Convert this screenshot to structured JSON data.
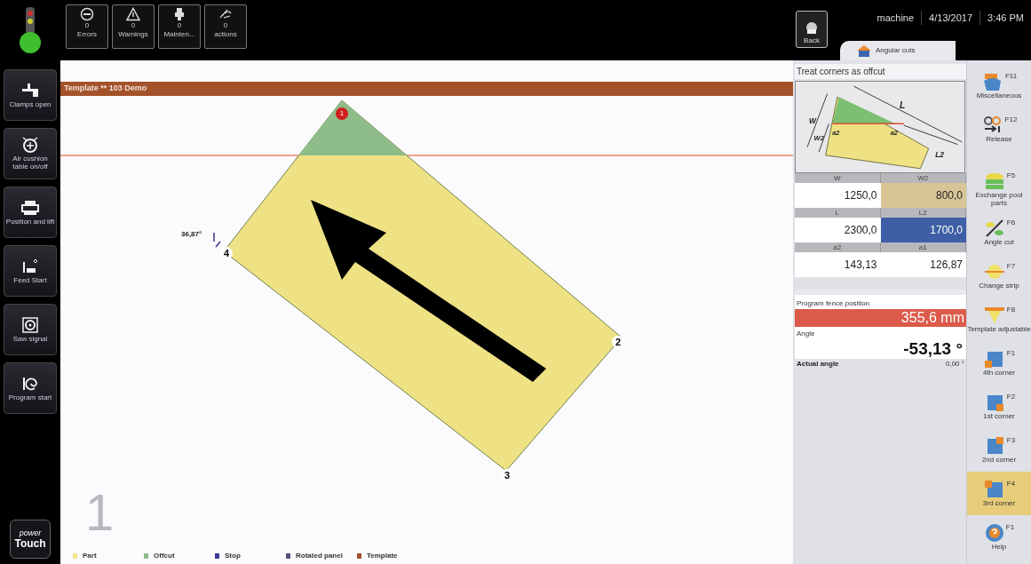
{
  "top_buttons": [
    {
      "count": "0",
      "label": "Errors"
    },
    {
      "count": "0",
      "label": "Warnings"
    },
    {
      "count": "0",
      "label": "Mainten..."
    },
    {
      "count": "0",
      "label": "actions"
    }
  ],
  "back_button": {
    "label": "Back"
  },
  "header": {
    "user": "machine",
    "date": "4/13/2017",
    "time": "3:46 PM"
  },
  "tab": {
    "label": "Angular cuts",
    "selected": true
  },
  "left_buttons": [
    {
      "label": "Clamps open"
    },
    {
      "label": "Air cushion table on/off"
    },
    {
      "label": "Position and lift"
    },
    {
      "label": "Feed Start"
    },
    {
      "label": "Saw signal"
    },
    {
      "label": "Program start"
    }
  ],
  "logo": {
    "line1": "power",
    "line2": "Touch"
  },
  "canvas": {
    "template_bar": "Template ** 103 Demo",
    "corners": [
      "1",
      "2",
      "3",
      "4"
    ],
    "angle_mark": "36,87°",
    "step": "1",
    "legend": [
      {
        "label": "Part",
        "color": "#f0e68c"
      },
      {
        "label": "Offcut",
        "color": "#8fbc8f"
      },
      {
        "label": "Stop",
        "color": "#3a3a9a"
      },
      {
        "label": "Rotated panel",
        "color": "#555577"
      },
      {
        "label": "Template",
        "color": "#a0522d"
      }
    ]
  },
  "panel": {
    "title": "Treat corners as offcut",
    "diagram_labels": [
      "W",
      "W2",
      "L",
      "L2",
      "a2",
      "a2"
    ],
    "fields": [
      {
        "label": "W",
        "value": "1250,0",
        "highlighted": false,
        "selected": false
      },
      {
        "label": "W2",
        "value": "800,0",
        "highlighted": true,
        "selected": false
      },
      {
        "label": "L",
        "value": "2300,0",
        "highlighted": false,
        "selected": false
      },
      {
        "label": "L2",
        "value": "1700,0",
        "highlighted": false,
        "selected": true
      },
      {
        "label": "a2",
        "value": "143,13",
        "highlighted": false,
        "selected": false
      },
      {
        "label": "a1",
        "value": "126,87",
        "highlighted": false,
        "selected": false
      }
    ],
    "fence_label": "Program fence position",
    "fence_value": "355,6 mm",
    "angle_label": "Angle",
    "angle_value": "-53,13 °",
    "actual_label": "Actual angle",
    "actual_value": "0,00 °"
  },
  "side_buttons": [
    {
      "label": "Miscellaneous",
      "key": "F11",
      "selected": false
    },
    {
      "label": "Release",
      "key": "F12",
      "selected": false
    },
    {
      "label": "Exchange pool parts",
      "key": "F5",
      "selected": false
    },
    {
      "label": "Angle cut",
      "key": "F6",
      "selected": false
    },
    {
      "label": "Change strip",
      "key": "F7",
      "selected": false
    },
    {
      "label": "Template adjustable",
      "key": "F8",
      "selected": false
    },
    {
      "label": "4th corner",
      "key": "F1",
      "selected": false
    },
    {
      "label": "1st corner",
      "key": "F2",
      "selected": false
    },
    {
      "label": "2nd corner",
      "key": "F3",
      "selected": false
    },
    {
      "label": "3rd corner",
      "key": "F4",
      "selected": true
    },
    {
      "label": "Help",
      "key": "F1",
      "selected": false
    }
  ]
}
